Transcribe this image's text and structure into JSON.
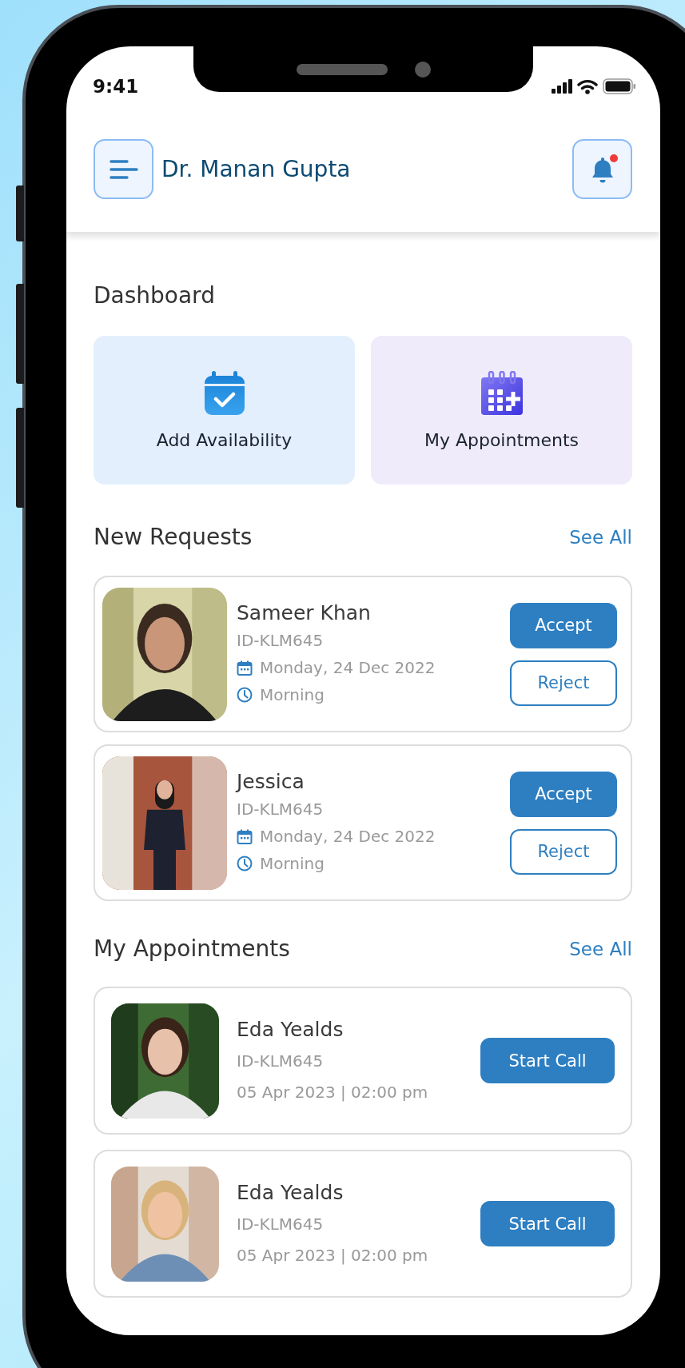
{
  "status_bar": {
    "time": "9:41"
  },
  "header": {
    "doctor_name": "Dr. Manan Gupta",
    "notifications": {
      "unread": true
    }
  },
  "dashboard": {
    "title": "Dashboard",
    "tiles": [
      {
        "kind": "availability",
        "label": "Add Availability"
      },
      {
        "kind": "appointments",
        "label": "My Appointments"
      }
    ]
  },
  "new_requests": {
    "title": "New Requests",
    "see_all": "See All",
    "items": [
      {
        "name": "Sameer Khan",
        "id": "ID-KLM645",
        "date": "Monday, 24 Dec 2022",
        "slot": "Morning",
        "accept": "Accept",
        "reject": "Reject"
      },
      {
        "name": "Jessica",
        "id": "ID-KLM645",
        "date": "Monday, 24 Dec 2022",
        "slot": "Morning",
        "accept": "Accept",
        "reject": "Reject"
      }
    ]
  },
  "my_appointments": {
    "title": "My Appointments",
    "see_all": "See All",
    "items": [
      {
        "name": "Eda Yealds",
        "id": "ID-KLM645",
        "when": "05 Apr 2023 | 02:00 pm",
        "action": "Start Call"
      },
      {
        "name": "Eda Yealds",
        "id": "ID-KLM645",
        "when": "05 Apr 2023 | 02:00 pm",
        "action": "Start Call"
      }
    ]
  }
}
